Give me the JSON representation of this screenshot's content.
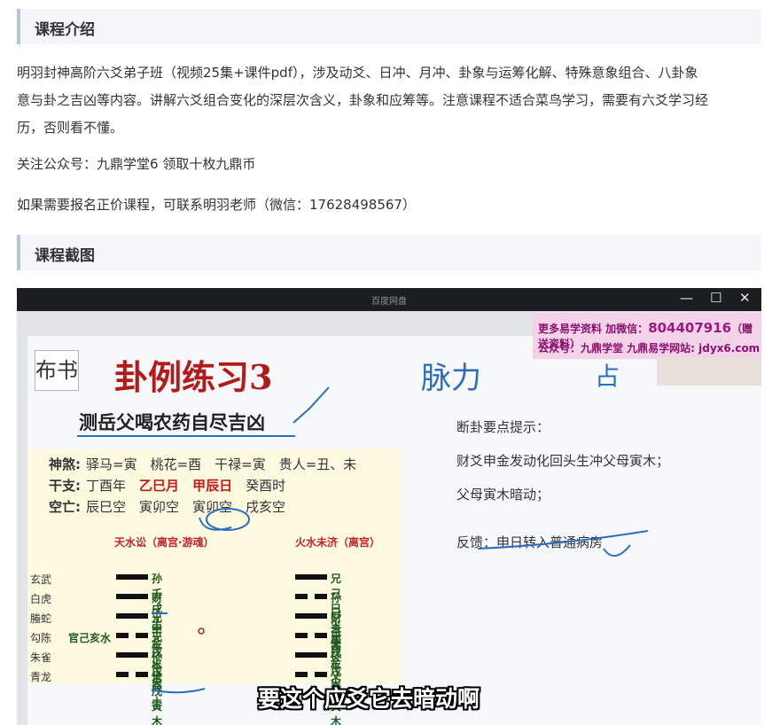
{
  "intro": {
    "heading": "课程介绍",
    "paragraph_line1": "明羽封神高阶六爻弟子班（视频25集+课件pdf），涉及动爻、日冲、月冲、卦象与运筹化解、特殊意象组合、八卦象",
    "paragraph_line2": "意与卦之吉凶等内容。讲解六爻组合变化的深层次含义，卦象和应筹等。注意课程不适合菜鸟学习，需要有六爻学习经",
    "paragraph_line3": "历，否则看不懂。",
    "follow": "关注公众号：九鼎学堂6 领取十枚九鼎币",
    "contact": "如果需要报名正价课程，可联系明羽老师（微信：17628498567）"
  },
  "screenshot_section": {
    "heading": "课程截图"
  },
  "window": {
    "title": "百度网盘",
    "minimize": "—",
    "maximize": "☐",
    "close": "✕"
  },
  "ad": {
    "line1": "更多易学资料 加微信：",
    "phone": "804407916",
    "line1_suffix": "（赠送资料）",
    "line2": "公众号：九鼎学堂 九鼎易学网站: jdyx6.com"
  },
  "slide": {
    "logo": "布书",
    "title": "卦例练习3",
    "subject": "测岳父喝农药自尽吉凶",
    "handwriting": "脉力",
    "handwriting2": "占",
    "info": {
      "shensha_label": "神煞:",
      "shensha": "驿马=寅　桃花=酉　干禄=寅　贵人=丑、未",
      "ganzhi_label": "干支:",
      "ganzhi_year": "丁酉年",
      "ganzhi_month": "乙巳月",
      "ganzhi_day": "甲辰日",
      "ganzhi_hour": "癸酉时",
      "kongwang_label": "空亡:",
      "kongwang": "辰巳空　寅卯空　寅卯空　戌亥空"
    },
    "hex_left_title": "天水讼（离宫·游魂）",
    "hex_right_title": "火水未济（离宫）",
    "six_gods": [
      "玄武",
      "白虎",
      "螣蛇",
      "勾陈",
      "朱雀",
      "青龙"
    ],
    "fushen": "官己亥水",
    "left_yao": [
      "孙壬戌土",
      "财壬申金",
      "兄壬午火世",
      "兄戊午火",
      "孙戊辰土",
      "父戊寅木应"
    ],
    "right_yao": [
      "兄己巳火应",
      "孙己未土",
      "财己酉金",
      "兄戊午火世",
      "孙戊辰土",
      "父戊寅木"
    ],
    "notes_title": "断卦要点提示：",
    "note1": "财爻申金发动化回头生冲父母寅木；",
    "note2": "父母寅木暗动；",
    "note3": "反馈：申日转入普通病房"
  },
  "subtitle": "要这个应爻它去暗动啊",
  "colors": {
    "accent_border": "#b7c4d3",
    "title_red": "#b31b1b",
    "ink_blue": "#2a6fbd",
    "ad_pink": "#f4d3e9"
  }
}
